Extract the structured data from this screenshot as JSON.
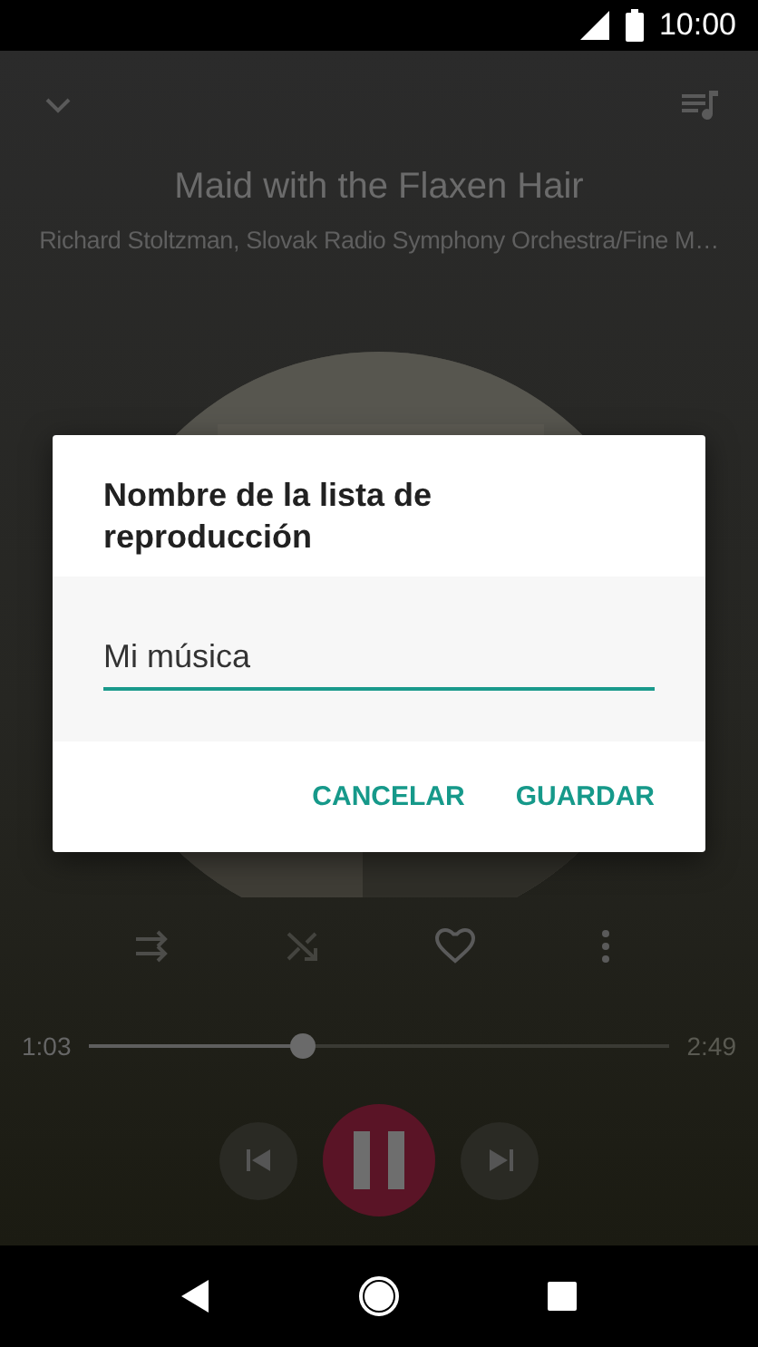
{
  "status_bar": {
    "time": "10:00"
  },
  "player": {
    "title": "Maid with the Flaxen Hair",
    "artist": "Richard Stoltzman, Slovak Radio Symphony Orchestra/Fine M…",
    "favorite": false,
    "elapsed": "1:03",
    "duration": "2:49",
    "progress": {
      "level": 0.37
    },
    "playing": true
  },
  "dialog": {
    "title": "Nombre de la lista de reproducción",
    "field": {
      "value": "Mi música"
    },
    "buttons": [
      {
        "label": "CANCELAR"
      },
      {
        "label": "GUARDAR"
      }
    ]
  }
}
